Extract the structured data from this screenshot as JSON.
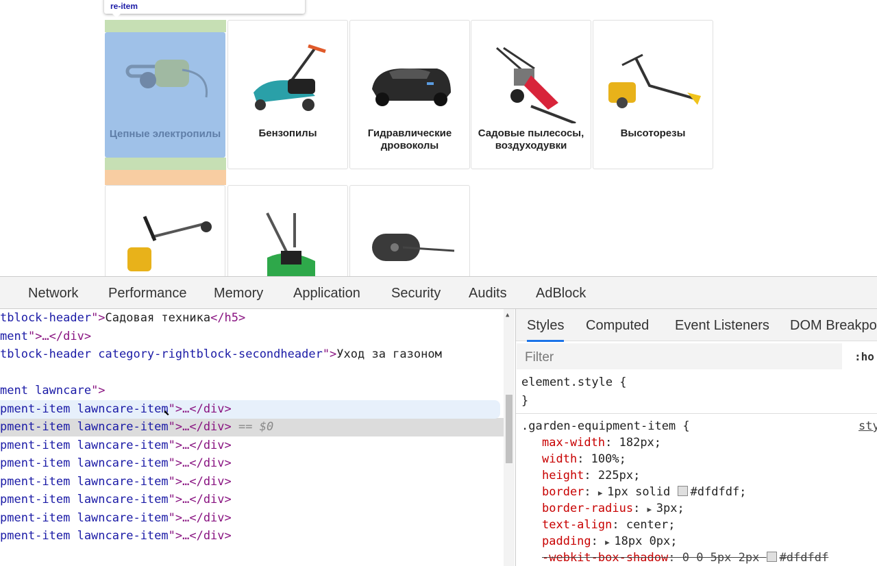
{
  "page": {
    "tooltip_text": "re-item",
    "tiles_row1": [
      {
        "label": "Цепные электропилы",
        "icon": "chainsaw-icon"
      },
      {
        "label": "Бензопилы",
        "icon": "lawnmower-icon"
      },
      {
        "label": "Гидравлические дровоколы",
        "icon": "robot-mower-icon"
      },
      {
        "label": "Садовые пылесосы, воздуходувки",
        "icon": "scythe-mower-icon"
      },
      {
        "label": "Высоторезы",
        "icon": "trimmer-icon"
      }
    ],
    "tiles_row2": [
      {
        "icon": "brushcutter-icon"
      },
      {
        "icon": "green-lawnmower-icon"
      },
      {
        "icon": "lawn-roller-icon"
      }
    ]
  },
  "devtools": {
    "tabs": [
      "Network",
      "Performance",
      "Memory",
      "Application",
      "Security",
      "Audits",
      "AdBlock"
    ],
    "elements": {
      "lines": [
        {
          "parts": [
            [
              "attr",
              "tblock-header"
            ],
            [
              "tag",
              "\">"
            ],
            [
              "txt",
              "Садовая техника"
            ],
            [
              "tag",
              "</h5>"
            ]
          ]
        },
        {
          "parts": [
            [
              "attr",
              "ment"
            ],
            [
              "tag",
              "\">…</div>"
            ]
          ]
        },
        {
          "parts": [
            [
              "attr",
              "tblock-header category-rightblock-secondheader"
            ],
            [
              "tag",
              "\">"
            ],
            [
              "txt",
              "Уход за газоном"
            ]
          ]
        },
        {
          "parts": []
        },
        {
          "parts": [
            [
              "attr",
              "ment lawncare"
            ],
            [
              "tag",
              "\">"
            ]
          ]
        },
        {
          "parts": [
            [
              "attr",
              "pment-item lawncare-item"
            ],
            [
              "tag",
              "\">…</div>"
            ]
          ]
        },
        {
          "parts": [
            [
              "attr",
              "pment-item lawncare-item"
            ],
            [
              "tag",
              "\">…</div>"
            ],
            [
              "eq",
              " == $0"
            ]
          ]
        },
        {
          "parts": [
            [
              "attr",
              "pment-item lawncare-item"
            ],
            [
              "tag",
              "\">…</div>"
            ]
          ]
        },
        {
          "parts": [
            [
              "attr",
              "pment-item lawncare-item"
            ],
            [
              "tag",
              "\">…</div>"
            ]
          ]
        },
        {
          "parts": [
            [
              "attr",
              "pment-item lawncare-item"
            ],
            [
              "tag",
              "\">…</div>"
            ]
          ]
        },
        {
          "parts": [
            [
              "attr",
              "pment-item lawncare-item"
            ],
            [
              "tag",
              "\">…</div>"
            ]
          ]
        },
        {
          "parts": [
            [
              "attr",
              "pment-item lawncare-item"
            ],
            [
              "tag",
              "\">…</div>"
            ]
          ]
        },
        {
          "parts": [
            [
              "attr",
              "pment-item lawncare-item"
            ],
            [
              "tag",
              "\">…</div>"
            ]
          ]
        }
      ]
    },
    "styles": {
      "subtabs": [
        "Styles",
        "Computed",
        "Event Listeners",
        "DOM Breakpo"
      ],
      "filter_placeholder": "Filter",
      "hov": ":ho",
      "element_style_open": "element.style {",
      "element_style_close": "}",
      "rule_selector": ".garden-equipment-item {",
      "rule_source": "sty",
      "props": [
        {
          "name": "max-width",
          "value": "182px;"
        },
        {
          "name": "width",
          "value": "100%;"
        },
        {
          "name": "height",
          "value": "225px;"
        },
        {
          "name": "border",
          "value": "1px solid",
          "tri": true,
          "swatch": "#dfdfdf",
          "after": "#dfdfdf;"
        },
        {
          "name": "border-radius",
          "value": "3px;",
          "tri": true
        },
        {
          "name": "text-align",
          "value": "center;"
        },
        {
          "name": "padding",
          "value": "18px 0px;",
          "tri": true
        },
        {
          "name": "-webkit-box-shadow",
          "value": "0 0 5px 2px",
          "swatch": "#dfdfdf",
          "after": "#dfdfdf",
          "struck": true
        }
      ]
    }
  }
}
